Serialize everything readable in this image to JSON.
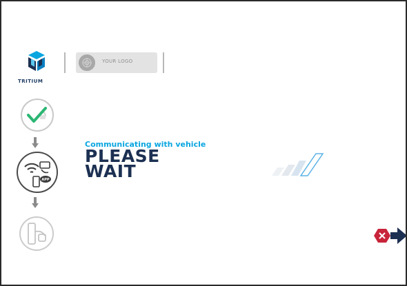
{
  "brand": {
    "name": "TRITIUM"
  },
  "custom_logo": {
    "text": "YOUR LOGO"
  },
  "message": {
    "status": "Communicating with vehicle",
    "headline_line1": "PLEASE",
    "headline_line2": "WAIT"
  },
  "steps": [
    {
      "icon": "plug-check-icon",
      "state": "done"
    },
    {
      "icon": "rfid-app-icon",
      "state": "active"
    },
    {
      "icon": "charging-connector-icon",
      "state": "pending"
    }
  ],
  "colors": {
    "primary": "#1c3052",
    "accent": "#0aa6e0",
    "check": "#2bb673",
    "cancel": "#c8243a"
  },
  "actions": {
    "cancel_icon": "cancel-exit-icon"
  }
}
